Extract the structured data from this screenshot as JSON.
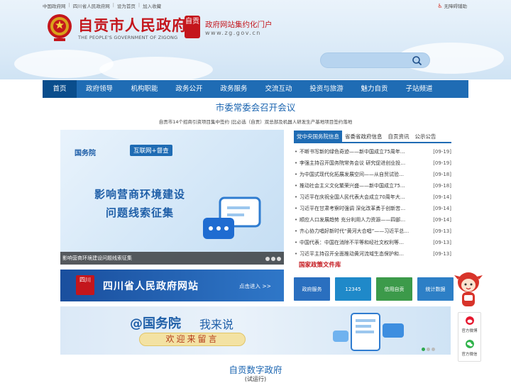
{
  "topbar": {
    "links": [
      "中国政府网",
      "四川省人民政府网",
      "设为首页",
      "加入收藏"
    ],
    "accessibility": "无障碍辅助"
  },
  "header": {
    "title": "自贡市人民政府",
    "title_en": "THE PEOPLE'S GOVERNMENT OF ZIGONG",
    "portal_title": "政府网站集约化门户",
    "portal_url": "www.zg.gov.cn",
    "logo_glyph": "自贡"
  },
  "search": {
    "placeholder": ""
  },
  "nav": {
    "items": [
      "首页",
      "政府领导",
      "机构职能",
      "政务公开",
      "政务服务",
      "交流互动",
      "投资与旅游",
      "魅力自贡",
      "子站频道"
    ],
    "active_index": 0
  },
  "headline": {
    "title": "市委常委会召开会议",
    "subtitle": "自贡市14个招商引资项目集中签约 |比必选（自贡）双总部及机器人研发生产基地项目签约落地"
  },
  "banner": {
    "brand": "国务院",
    "tag": "互联网+督查",
    "line1": "影响营商环境建设",
    "line2": "问题线索征集",
    "caption": "影响营商环境建设问题线索征集"
  },
  "province_banner": {
    "seal_text": "四川",
    "title": "四川省人民政府网站",
    "enter": "点击进入 >>"
  },
  "news": {
    "tabs": [
      "党中央国务院信息",
      "省委省政府信息",
      "自贡资讯",
      "公示公告"
    ],
    "active_tab": 0,
    "items": [
      {
        "title": "不断书写新的绿色奇迹——新中国成立75周年…",
        "date": "[09-19]"
      },
      {
        "title": "李强主持召开国务院常务会议 研究促进创业投…",
        "date": "[09-19]"
      },
      {
        "title": "为中国式现代化拓展发展空间——从自贸试验…",
        "date": "[09-18]"
      },
      {
        "title": "推动社会主义文化繁荣兴盛——新中国成立75…",
        "date": "[09-18]"
      },
      {
        "title": "习近平在庆祝全国人民代表大会成立70周年大…",
        "date": "[09-14]"
      },
      {
        "title": "习近平在甘肃考察时强调 深化改革勇于创新苦…",
        "date": "[09-14]"
      },
      {
        "title": "顺应人口发展趋势 充分利用人力资源——四部…",
        "date": "[09-14]"
      },
      {
        "title": "齐心协力唱好新时代“黄河大合唱”——习近平总…",
        "date": "[09-13]"
      },
      {
        "title": "中国代表：中国在消除不平等和经社文权利等…",
        "date": "[09-13]"
      },
      {
        "title": "习近平主持召开全面推动黄河流域生态保护和…",
        "date": "[09-13]"
      }
    ],
    "policy_link": "国家政策文件库"
  },
  "thumbs": [
    {
      "label": "政府服务",
      "color": "#2a6fbf"
    },
    {
      "label": "12345",
      "color": "#1f89c9"
    },
    {
      "label": "信用自贡",
      "color": "#3c9a4a"
    },
    {
      "label": "统计数据",
      "color": "#2d7fc6"
    }
  ],
  "wide_banner": {
    "title_a": "@国务院",
    "title_b": "我来说",
    "pill": "欢迎来留言"
  },
  "digital": {
    "title": "自贡数字政府",
    "subtitle": "(试运行)"
  },
  "side": {
    "weibo": "官方微博",
    "wechat": "官方微信"
  },
  "colors": {
    "brand_red": "#c4161c",
    "nav_blue": "#1f6cb4",
    "nav_active": "#0a4d8c",
    "heading_blue": "#1a64b0"
  }
}
